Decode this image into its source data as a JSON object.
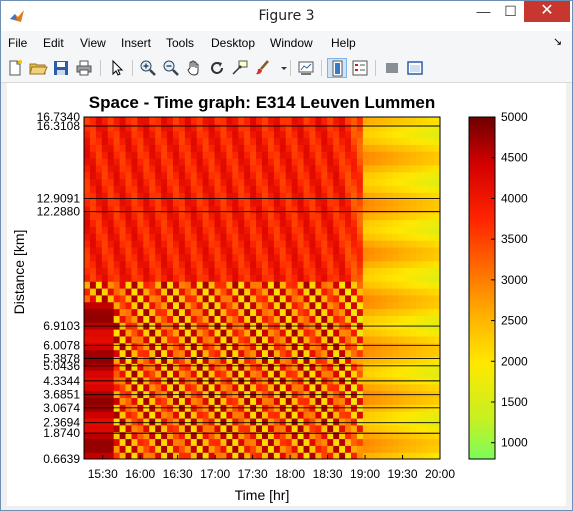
{
  "window": {
    "title": "Figure 3",
    "minimize_glyph": "—",
    "maximize_glyph": "☐",
    "close_glyph": "✕"
  },
  "menu": {
    "items": [
      "File",
      "Edit",
      "View",
      "Insert",
      "Tools",
      "Desktop",
      "Window",
      "Help"
    ],
    "dock_glyph": "↘"
  },
  "toolbar": {
    "buttons": [
      {
        "name": "new-figure",
        "icon": "new-file-icon"
      },
      {
        "name": "open-file",
        "icon": "folder-open-icon"
      },
      {
        "name": "save-figure",
        "icon": "save-icon"
      },
      {
        "name": "print-figure",
        "icon": "printer-icon"
      },
      {
        "name": "edit-plot",
        "icon": "arrow-cursor-icon"
      },
      {
        "name": "zoom-in",
        "icon": "zoom-in-icon"
      },
      {
        "name": "zoom-out",
        "icon": "zoom-out-icon"
      },
      {
        "name": "pan",
        "icon": "hand-icon"
      },
      {
        "name": "rotate-3d",
        "icon": "rotate-icon"
      },
      {
        "name": "data-cursor",
        "icon": "data-cursor-icon"
      },
      {
        "name": "brush",
        "icon": "brush-icon"
      },
      {
        "name": "link-plot",
        "icon": "link-plot-icon"
      },
      {
        "name": "insert-colorbar",
        "icon": "colorbar-icon"
      },
      {
        "name": "insert-legend",
        "icon": "legend-icon"
      },
      {
        "name": "hide-plot-tools",
        "icon": "hide-tools-icon"
      },
      {
        "name": "show-plot-tools",
        "icon": "show-tools-icon"
      }
    ]
  },
  "colors": {
    "colormap": [
      "#7cfc5c",
      "#c8f020",
      "#ffe800",
      "#ffb000",
      "#ff6a00",
      "#ff2400",
      "#d40000",
      "#6e0000"
    ],
    "window_border": "#6d8fb3",
    "close_button": "#c7372f"
  },
  "chart_data": {
    "type": "heatmap",
    "title": "Space - Time graph: E314 Leuven Lummen",
    "xlabel": "Time [hr]",
    "ylabel": "Distance [km]",
    "x_ticks": [
      "15:30",
      "16:00",
      "16:30",
      "17:00",
      "17:30",
      "18:00",
      "18:30",
      "19:00",
      "19:30",
      "20:00"
    ],
    "xlim": [
      "15:15",
      "20:00"
    ],
    "ylim": [
      0.6639,
      16.734
    ],
    "y_ticks": [
      0.6639,
      1.874,
      2.3694,
      3.0674,
      3.6851,
      4.3344,
      5.0436,
      5.3878,
      6.0078,
      6.9103,
      12.288,
      12.9091,
      16.3108,
      16.734
    ],
    "y_tick_labels": [
      "0.6639",
      "1.8740",
      "2.3694",
      "3.0674",
      "3.6851",
      "4.3344",
      "5.0436",
      "5.3878",
      "6.0078",
      "6.9103",
      "12.2880",
      "12.9091",
      "16.3108",
      "16.7340"
    ],
    "colorbar": {
      "range": [
        800,
        5000
      ],
      "ticks": [
        1000,
        1500,
        2000,
        2500,
        3000,
        3500,
        4000,
        4500,
        5000
      ],
      "tick_labels": [
        "1000",
        "1500",
        "2000",
        "2500",
        "3000",
        "3500",
        "4000",
        "4500",
        "5000"
      ]
    },
    "grid": "horizontal lines at detector positions",
    "description_values": {
      "congested_until": "19:00"
    }
  }
}
